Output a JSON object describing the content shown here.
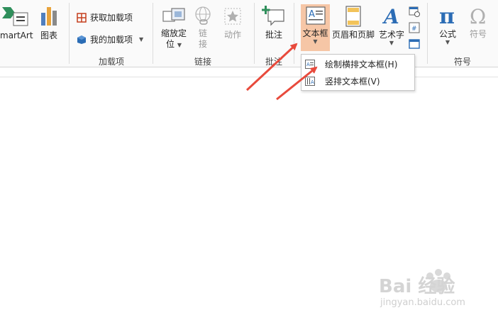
{
  "ribbon": {
    "insert_group": {
      "smartart_label": "martArt",
      "chart_label": "图表"
    },
    "addins_group": {
      "label": "加载项",
      "get_addins": "获取加载项",
      "my_addins": "我的加载项"
    },
    "links_group": {
      "label": "链接",
      "zoom_line1": "缩放定",
      "zoom_line2": "位",
      "link_line1": "链",
      "link_line2": "接",
      "action_label": "动作"
    },
    "comments_group": {
      "label": "批注",
      "comment_label": "批注"
    },
    "text_group": {
      "textbox_label": "文本框",
      "header_footer_label": "页眉和页脚",
      "wordart_label": "艺术字"
    },
    "symbols_group": {
      "label": "符号",
      "equation_label": "公式",
      "symbol_label": "符号"
    }
  },
  "textbox_menu": {
    "items": [
      {
        "label": "绘制横排文本框(H)"
      },
      {
        "label": "竖排文本框(V)"
      }
    ]
  },
  "watermark": {
    "brand": "Bai 经验",
    "url": "jingyan.baidu.com"
  },
  "colors": {
    "accent_highlight": "#f6c6a6",
    "arrow": "#e84a3c",
    "office_red": "#c43e1c",
    "office_blue": "#2b6cb5"
  }
}
